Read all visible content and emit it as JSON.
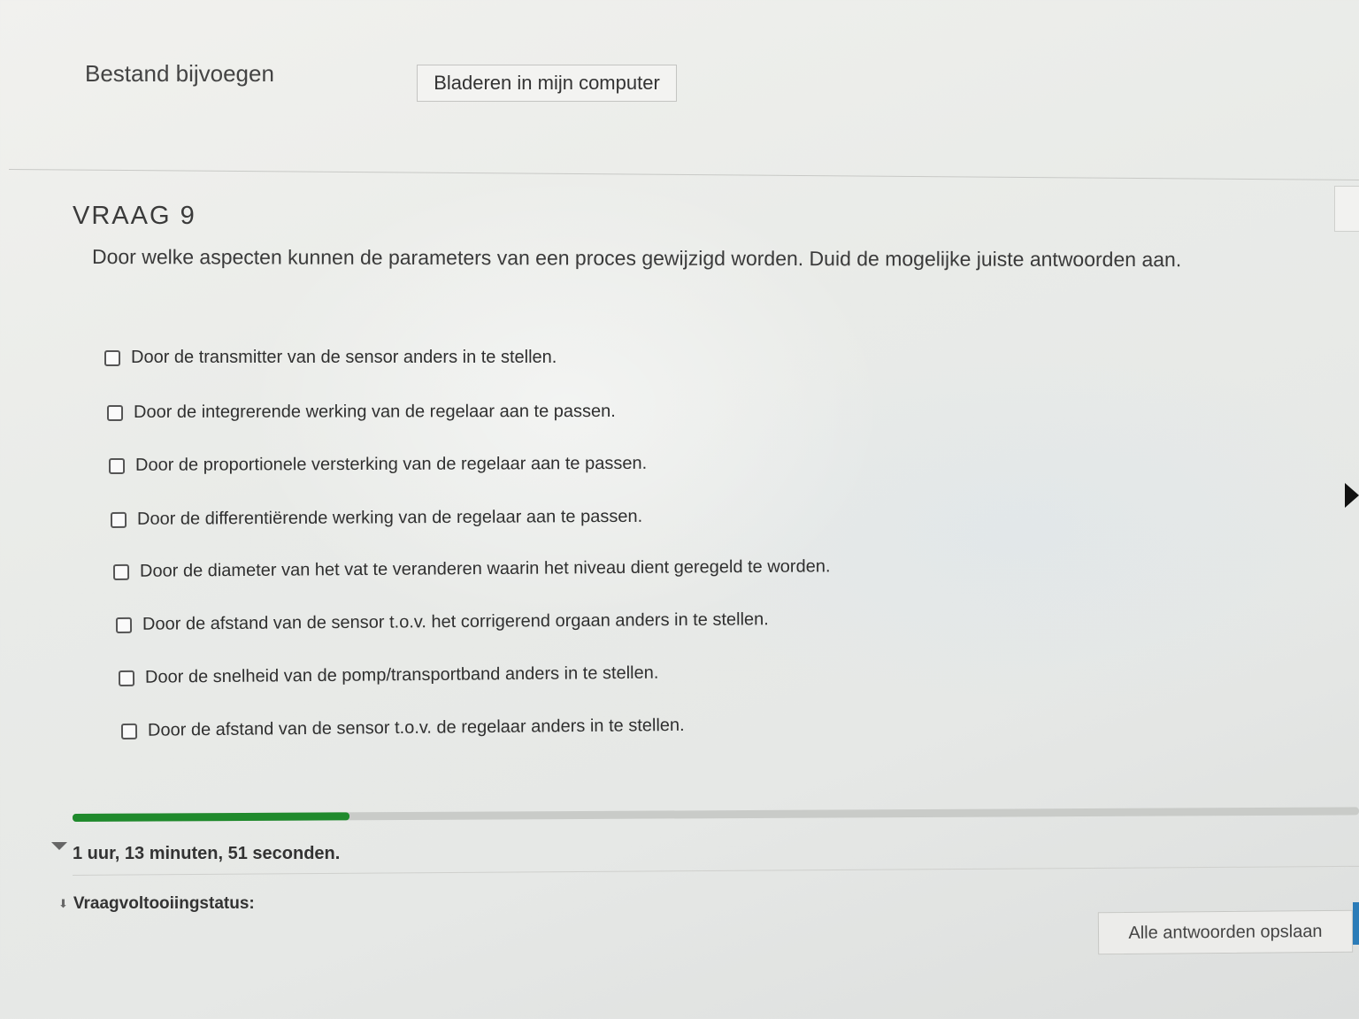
{
  "attachment": {
    "label": "Bestand bijvoegen",
    "browse_button": "Bladeren in mijn computer"
  },
  "question": {
    "title": "VRAAG 9",
    "text": "Door welke aspecten kunnen de parameters van een proces gewijzigd worden. Duid de mogelijke juiste antwoorden aan.",
    "options": [
      {
        "label": "Door de transmitter van de sensor anders in te stellen.",
        "checked": false
      },
      {
        "label": "Door de integrerende werking van de regelaar aan te passen.",
        "checked": false
      },
      {
        "label": "Door de proportionele versterking van de regelaar aan te passen.",
        "checked": false
      },
      {
        "label": "Door de differentiërende werking van de regelaar aan te passen.",
        "checked": false
      },
      {
        "label": "Door de diameter van het vat te veranderen waarin het niveau dient geregeld te worden.",
        "checked": false
      },
      {
        "label": "Door de afstand van de sensor t.o.v. het corrigerend orgaan anders in te stellen.",
        "checked": false
      },
      {
        "label": "Door de snelheid van de pomp/transportband anders in te stellen.",
        "checked": false
      },
      {
        "label": "Door de afstand van de sensor t.o.v. de regelaar anders in te stellen.",
        "checked": false
      }
    ]
  },
  "timer": {
    "remaining_text": "1 uur, 13 minuten, 51 seconden.",
    "progress_fraction": 0.215,
    "progress_color": "#1f8a2c"
  },
  "status": {
    "label": "Vraagvoltooiingstatus:",
    "icon": "chevron-double-down-icon"
  },
  "footer": {
    "save_all_button": "Alle antwoorden opslaan"
  },
  "colors": {
    "accent": "#2b7cb8",
    "progress": "#1f8a2c"
  }
}
